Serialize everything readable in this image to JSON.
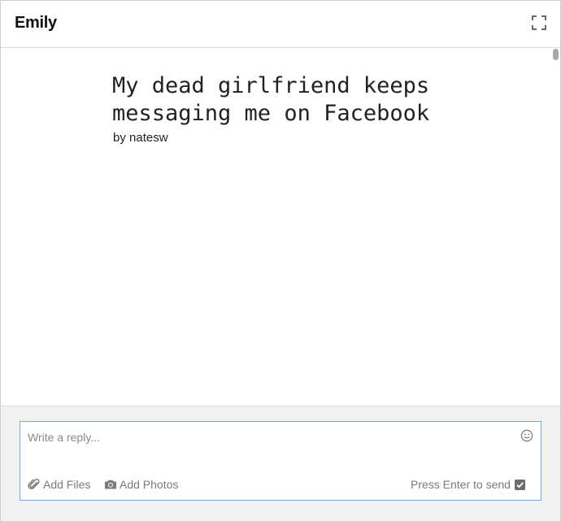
{
  "header": {
    "title": "Emily",
    "expand_icon": "fullscreen-icon"
  },
  "story": {
    "title": "My dead girlfriend keeps\nmessaging me on Facebook",
    "byline": "by natesw"
  },
  "reply": {
    "placeholder": "Write a reply...",
    "value": "",
    "emoji_icon": "smiley-icon",
    "add_files_label": "Add Files",
    "add_files_icon": "paperclip-icon",
    "add_photos_label": "Add Photos",
    "add_photos_icon": "camera-icon",
    "press_enter_label": "Press Enter to send",
    "press_enter_checked": true
  },
  "colors": {
    "input_border": "#7aa3e8",
    "footer_bg": "#f1f1f1",
    "muted_text": "#7a7a7a",
    "checkbox": "#6d6d6d"
  }
}
